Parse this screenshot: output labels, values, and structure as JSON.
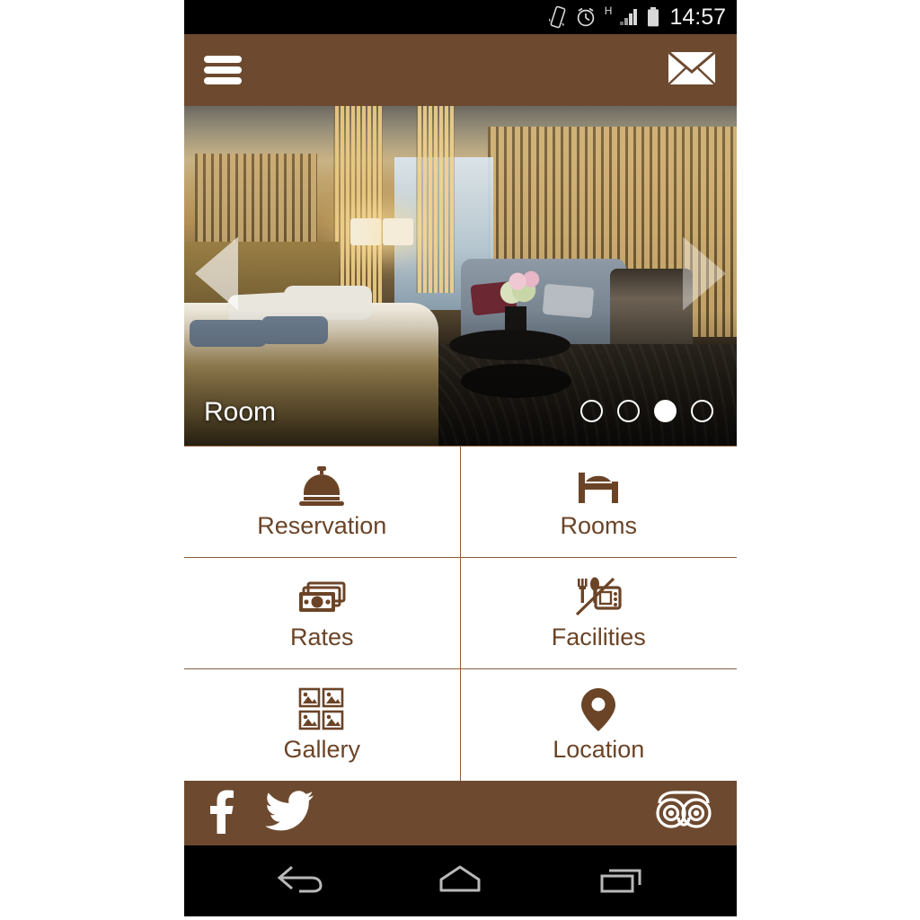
{
  "status_bar": {
    "time": "14:57",
    "icons": [
      "vibrate-icon",
      "alarm-clock-icon",
      "signal-h-icon",
      "battery-icon"
    ],
    "network_label": "H"
  },
  "app_bar": {
    "menu_icon": "hamburger-menu-icon",
    "mail_icon": "envelope-icon"
  },
  "hero": {
    "caption": "Room",
    "prev_icon": "chevron-left-icon",
    "next_icon": "chevron-right-icon",
    "slide_count": 4,
    "active_slide": 3,
    "photo_alt": "hotel room with bed, sofa, flowers and curtains"
  },
  "menu": {
    "items": [
      {
        "label": "Reservation",
        "icon": "service-bell-icon"
      },
      {
        "label": "Rooms",
        "icon": "bed-icon"
      },
      {
        "label": "Rates",
        "icon": "banknotes-icon"
      },
      {
        "label": "Facilities",
        "icon": "cutlery-appliance-icon"
      },
      {
        "label": "Gallery",
        "icon": "photo-grid-icon"
      },
      {
        "label": "Location",
        "icon": "map-pin-icon"
      }
    ]
  },
  "social": {
    "facebook": "facebook-icon",
    "twitter": "twitter-icon",
    "tripadvisor": "tripadvisor-owl-icon"
  },
  "nav_bar": {
    "back": "back-icon",
    "home": "home-icon",
    "recents": "recent-apps-icon"
  },
  "colors": {
    "brand_brown": "#6d4a2f",
    "label_brown": "#6b4427",
    "divider_brown": "#8b5e3c",
    "white": "#ffffff",
    "black": "#000000"
  }
}
